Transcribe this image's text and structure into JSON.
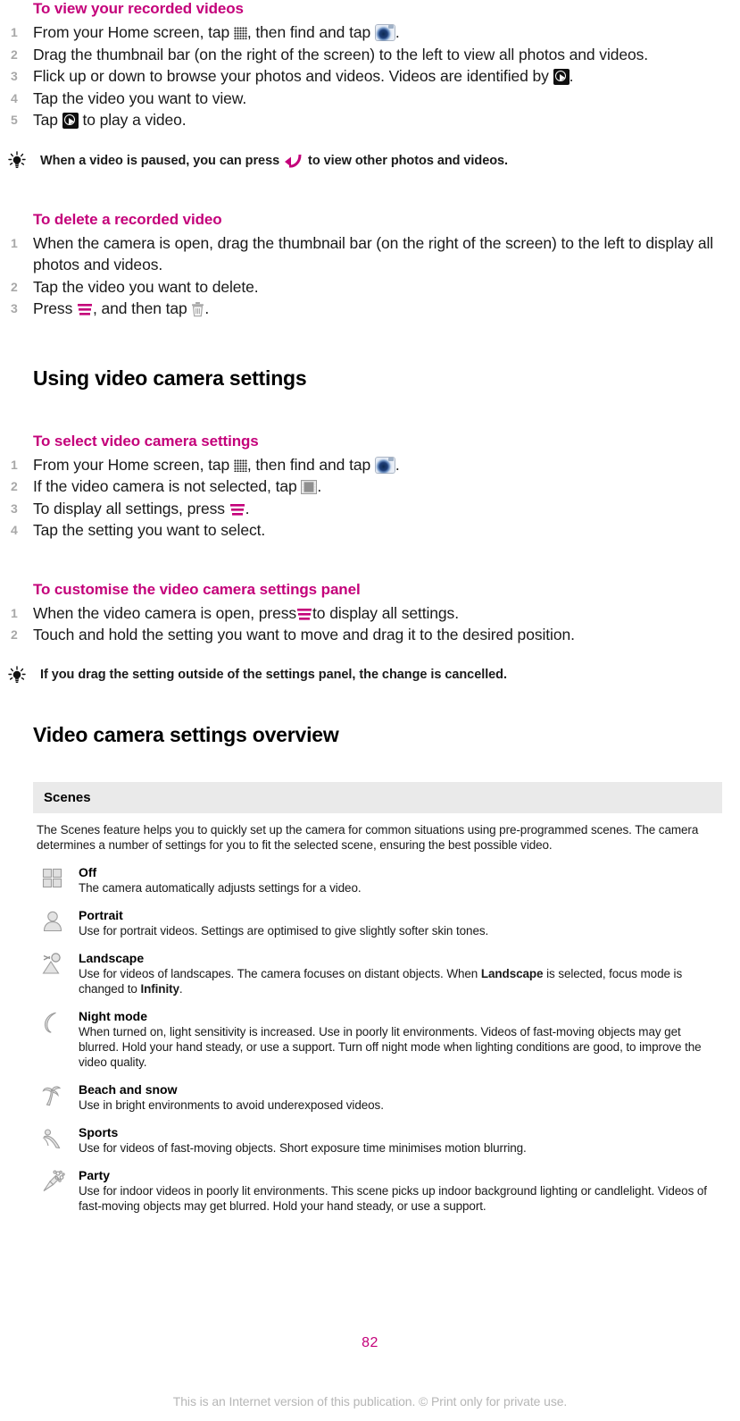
{
  "document": {
    "page_number": "82",
    "footnote": "This is an Internet version of this publication. © Print only for private use.",
    "accent_color": "#c4007a",
    "step_number_color": "#a8a8a8",
    "scene_header_bg": "#eaeaea"
  },
  "sections": [
    {
      "id": "view-recorded-videos",
      "heading": "To view your recorded videos",
      "steps": [
        {
          "num": "1",
          "text_before": "From your Home screen, tap ",
          "icon1": "apps-grid-icon",
          "text_mid": ", then find and tap ",
          "icon2": "camera-icon",
          "text_after": "."
        },
        {
          "num": "2",
          "text_before": "Drag the thumbnail bar (on the right of the screen) to the left to view all photos and videos.",
          "icon1": "",
          "text_mid": "",
          "icon2": "",
          "text_after": ""
        },
        {
          "num": "3",
          "text_before": "Flick up or down to browse your photos and videos. Videos are identified by ",
          "icon1": "play-icon",
          "text_mid": "",
          "icon2": "",
          "text_after": "."
        },
        {
          "num": "4",
          "text_before": "Tap the video you want to view.",
          "icon1": "",
          "text_mid": "",
          "icon2": "",
          "text_after": ""
        },
        {
          "num": "5",
          "text_before": "Tap ",
          "icon1": "play-icon",
          "text_mid": " to play a video.",
          "icon2": "",
          "text_after": ""
        }
      ],
      "tip": {
        "text_before": "When a video is paused, you can press ",
        "icon": "back-arrow-icon",
        "text_after": " to view other photos and videos."
      }
    },
    {
      "id": "delete-recorded-video",
      "heading": "To delete a recorded video",
      "steps": [
        {
          "num": "1",
          "text_before": "When the camera is open, drag the thumbnail bar (on the right of the screen) to the left to display all photos and videos.",
          "icon1": "",
          "text_mid": "",
          "icon2": "",
          "text_after": ""
        },
        {
          "num": "2",
          "text_before": "Tap the video you want to delete.",
          "icon1": "",
          "text_mid": "",
          "icon2": "",
          "text_after": ""
        },
        {
          "num": "3",
          "text_before": "Press ",
          "icon1": "menu-icon",
          "text_mid": ", and then tap ",
          "icon2": "trash-icon",
          "text_after": "."
        }
      ]
    }
  ],
  "main_heading_1": "Using video camera settings",
  "sections2": [
    {
      "id": "select-video-camera-settings",
      "heading": "To select video camera settings",
      "steps": [
        {
          "num": "1",
          "text_before": "From your Home screen, tap ",
          "icon1": "apps-grid-icon",
          "text_mid": ", then find and tap ",
          "icon2": "camera-icon",
          "text_after": "."
        },
        {
          "num": "2",
          "text_before": "If the video camera is not selected, tap ",
          "icon1": "film-strip-icon",
          "text_mid": "",
          "icon2": "",
          "text_after": "."
        },
        {
          "num": "3",
          "text_before": "To display all settings, press ",
          "icon1": "menu-icon",
          "text_mid": "",
          "icon2": "",
          "text_after": "."
        },
        {
          "num": "4",
          "text_before": "Tap the setting you want to select.",
          "icon1": "",
          "text_mid": "",
          "icon2": "",
          "text_after": ""
        }
      ]
    },
    {
      "id": "customise-settings-panel",
      "heading": "To customise the video camera settings panel",
      "steps": [
        {
          "num": "1",
          "text_before": "When the video camera is open, press",
          "icon1": "menu-icon",
          "text_mid": "to display all settings.",
          "icon2": "",
          "text_after": ""
        },
        {
          "num": "2",
          "text_before": "Touch and hold the setting you want to move and drag it to the desired position.",
          "icon1": "",
          "text_mid": "",
          "icon2": "",
          "text_after": ""
        }
      ],
      "tip": {
        "text_before": "If you drag the setting outside of the settings panel, the change is cancelled.",
        "icon": "",
        "text_after": ""
      }
    }
  ],
  "main_heading_2": "Video camera settings overview",
  "scenes_table": {
    "header": "Scenes",
    "intro": "The Scenes feature helps you to quickly set up the camera for common situations using pre-programmed scenes. The camera determines a number of settings for you to fit the selected scene, ensuring the best possible video.",
    "rows": [
      {
        "icon": "grid-squares-icon",
        "title": "Off",
        "desc": "The camera automatically adjusts settings for a video."
      },
      {
        "icon": "portrait-person-icon",
        "title": "Portrait",
        "desc": "Use for portrait videos. Settings are optimised to give slightly softer skin tones."
      },
      {
        "icon": "landscape-mountain-icon",
        "title": "Landscape",
        "desc_part1": "Use for videos of landscapes. The camera focuses on distant objects. When ",
        "desc_bold1": "Landscape",
        "desc_part2": " is selected, focus mode is changed to ",
        "desc_bold2": "Infinity",
        "desc_part3": "."
      },
      {
        "icon": "night-moon-icon",
        "title": "Night mode",
        "desc": "When turned on, light sensitivity is increased. Use in poorly lit environments. Videos of fast-moving objects may get blurred. Hold your hand steady, or use a support. Turn off night mode when lighting conditions are good, to improve the video quality."
      },
      {
        "icon": "beach-palm-icon",
        "title": "Beach and snow",
        "desc": "Use in bright environments to avoid underexposed videos."
      },
      {
        "icon": "sports-runner-icon",
        "title": "Sports",
        "desc": "Use for videos of fast-moving objects. Short exposure time minimises motion blurring."
      },
      {
        "icon": "party-popper-icon",
        "title": "Party",
        "desc": "Use for indoor videos in poorly lit environments. This scene picks up indoor background lighting or candlelight. Videos of fast-moving objects may get blurred. Hold your hand steady, or use a support."
      }
    ]
  }
}
